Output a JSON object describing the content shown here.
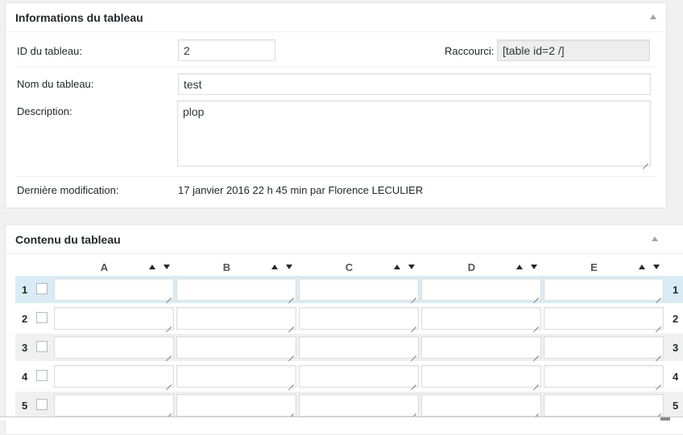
{
  "info_box": {
    "title": "Informations du tableau",
    "id_label": "ID du tableau:",
    "id_value": "2",
    "shortcode_label": "Raccourci:",
    "shortcode_value": "[table id=2 /]",
    "name_label": "Nom du tableau:",
    "name_value": "test",
    "description_label": "Description:",
    "description_value": "plop",
    "modified_label": "Dernière modification:",
    "modified_value": "17 janvier 2016 22 h 45 min par Florence LECULIER"
  },
  "content_box": {
    "title": "Contenu du tableau",
    "columns": [
      "A",
      "B",
      "C",
      "D",
      "E"
    ],
    "rows": [
      "1",
      "2",
      "3",
      "4",
      "5"
    ]
  },
  "colors": {
    "highlight_row": "#d9ecf5",
    "alt_row": "#f0f0f0",
    "readonly_field": "#eeeeee"
  }
}
